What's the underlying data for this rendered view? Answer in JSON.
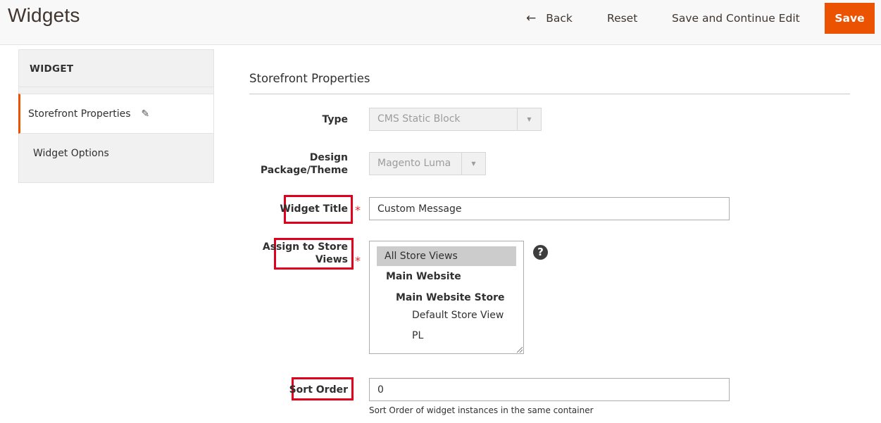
{
  "header": {
    "title": "Widgets",
    "actions": {
      "back_label": "Back",
      "back_icon": "arrow-left-icon",
      "reset_label": "Reset",
      "save_continue_label": "Save and Continue Edit",
      "save_label": "Save"
    },
    "accent_color": "#eb5202"
  },
  "sidebar": {
    "title": "WIDGET",
    "items": [
      {
        "label": "Storefront Properties",
        "active": true,
        "icon": "pencil-icon"
      },
      {
        "label": "Widget Options",
        "active": false
      }
    ]
  },
  "form": {
    "section_title": "Storefront Properties",
    "fields": {
      "type": {
        "label": "Type",
        "value": "CMS Static Block",
        "disabled": true
      },
      "theme": {
        "label_line1": "Design",
        "label_line2": "Package/Theme",
        "value": "Magento Luma",
        "disabled": true
      },
      "widget_title": {
        "label": "Widget Title",
        "required": true,
        "value": "Custom Message"
      },
      "store_views": {
        "label_line1": "Assign to Store",
        "label_line2": "Views",
        "required": true,
        "help_icon": "question-circle-icon",
        "options": [
          {
            "label": "All Store Views",
            "selected": true,
            "level": 0,
            "bold": false
          },
          {
            "label": "Main Website",
            "selected": false,
            "level": 1,
            "bold": true
          },
          {
            "label": "Main Website Store",
            "selected": false,
            "level": 2,
            "bold": true
          },
          {
            "label": "Default Store View",
            "selected": false,
            "level": 3,
            "bold": false
          },
          {
            "label": "PL",
            "selected": false,
            "level": 3,
            "bold": false
          }
        ]
      },
      "sort_order": {
        "label": "Sort Order",
        "value": "0",
        "note": "Sort Order of widget instances in the same container"
      }
    },
    "required_marker": "*"
  }
}
